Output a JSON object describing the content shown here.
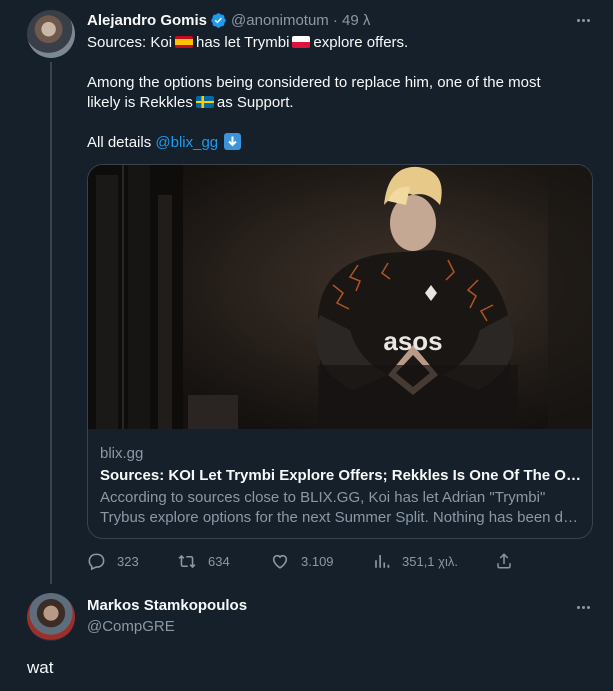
{
  "tweet": {
    "author_name": "Alejandro Gomis",
    "author_handle": "@anonimotum",
    "time": "· 49 λ",
    "lines": [
      "Sources: Koi",
      "has let Trymbi",
      "explore offers.",
      "Among the options being considered to replace him, one of the most",
      "likely is Rekkles",
      "as Support.",
      "All details",
      "@blix_gg"
    ],
    "card": {
      "domain": "blix.gg",
      "title": "Sources: KOI Let Trymbi Explore Offers; Rekkles Is One Of The Options To Replace Him",
      "description_line1": "According to sources close to BLIX.GG, Koi has let Adrian \"Trymbi\"",
      "description_line2": "Trybus explore options for the next Summer Split. Nothing has been decided yet",
      "image_text": "asos"
    },
    "stats": {
      "replies": "323",
      "retweets": "634",
      "likes": "3.109",
      "views": "351,1 χιλ."
    }
  },
  "reply": {
    "author_name": "Markos Stamkopoulos",
    "author_handle": "@CompGRE",
    "text": "wat"
  },
  "colors": {
    "background": "#15202b",
    "text": "#f7f9f9",
    "muted": "#8b98a5",
    "link": "#1d9bf0",
    "border": "#38444d"
  },
  "icons": [
    "verified-badge-icon",
    "more-options-icon",
    "reply-icon",
    "retweet-icon",
    "like-icon",
    "views-icon",
    "share-icon",
    "arrow-down-emoji",
    "flag-spain",
    "flag-poland",
    "flag-sweden"
  ]
}
